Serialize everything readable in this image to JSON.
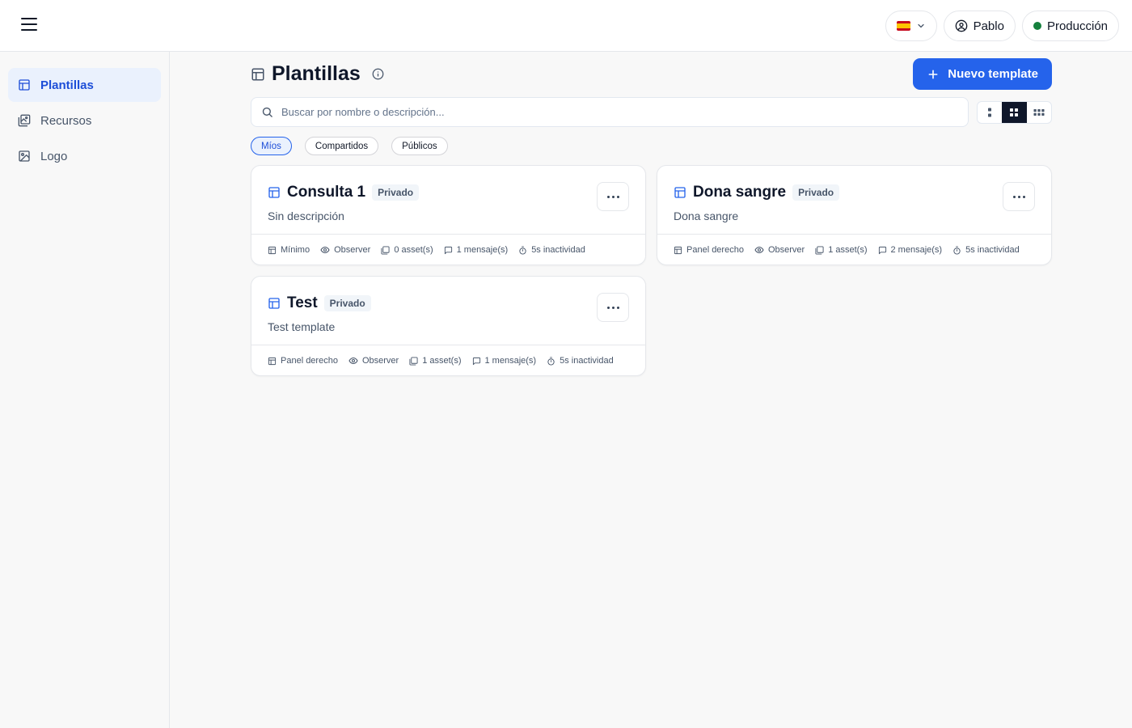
{
  "topbar": {
    "language_flag": "spain-flag",
    "user_name": "Pablo",
    "environment": "Producción",
    "environment_color": "#15803d"
  },
  "sidebar": {
    "items": [
      {
        "label": "Plantillas",
        "icon": "template-icon",
        "active": true
      },
      {
        "label": "Recursos",
        "icon": "images-icon",
        "active": false
      },
      {
        "label": "Logo",
        "icon": "image-icon",
        "active": false
      }
    ]
  },
  "main": {
    "title": "Plantillas",
    "new_button_label": "Nuevo template",
    "search_placeholder": "Buscar por nombre o descripción...",
    "view_modes": [
      "list",
      "grid-2",
      "grid-3"
    ],
    "active_view": "grid-2",
    "filters": [
      {
        "label": "Míos",
        "active": true
      },
      {
        "label": "Compartidos",
        "active": false
      },
      {
        "label": "Públicos",
        "active": false
      }
    ]
  },
  "cards": [
    {
      "title": "Consulta 1",
      "badge": "Privado",
      "description": "Sin descripción",
      "layout": "Mínimo",
      "mode": "Observer",
      "assets": "0 asset(s)",
      "messages": "1 mensaje(s)",
      "inactivity": "5s inactividad"
    },
    {
      "title": "Dona sangre",
      "badge": "Privado",
      "description": "Dona sangre",
      "layout": "Panel derecho",
      "mode": "Observer",
      "assets": "1 asset(s)",
      "messages": "2 mensaje(s)",
      "inactivity": "5s inactividad"
    },
    {
      "title": "Test",
      "badge": "Privado",
      "description": "Test template",
      "layout": "Panel derecho",
      "mode": "Observer",
      "assets": "1 asset(s)",
      "messages": "1 mensaje(s)",
      "inactivity": "5s inactividad"
    }
  ],
  "colors": {
    "accent": "#2563eb",
    "active_nav_bg": "#eaf1fd",
    "page_bg": "#f8f8f8"
  }
}
